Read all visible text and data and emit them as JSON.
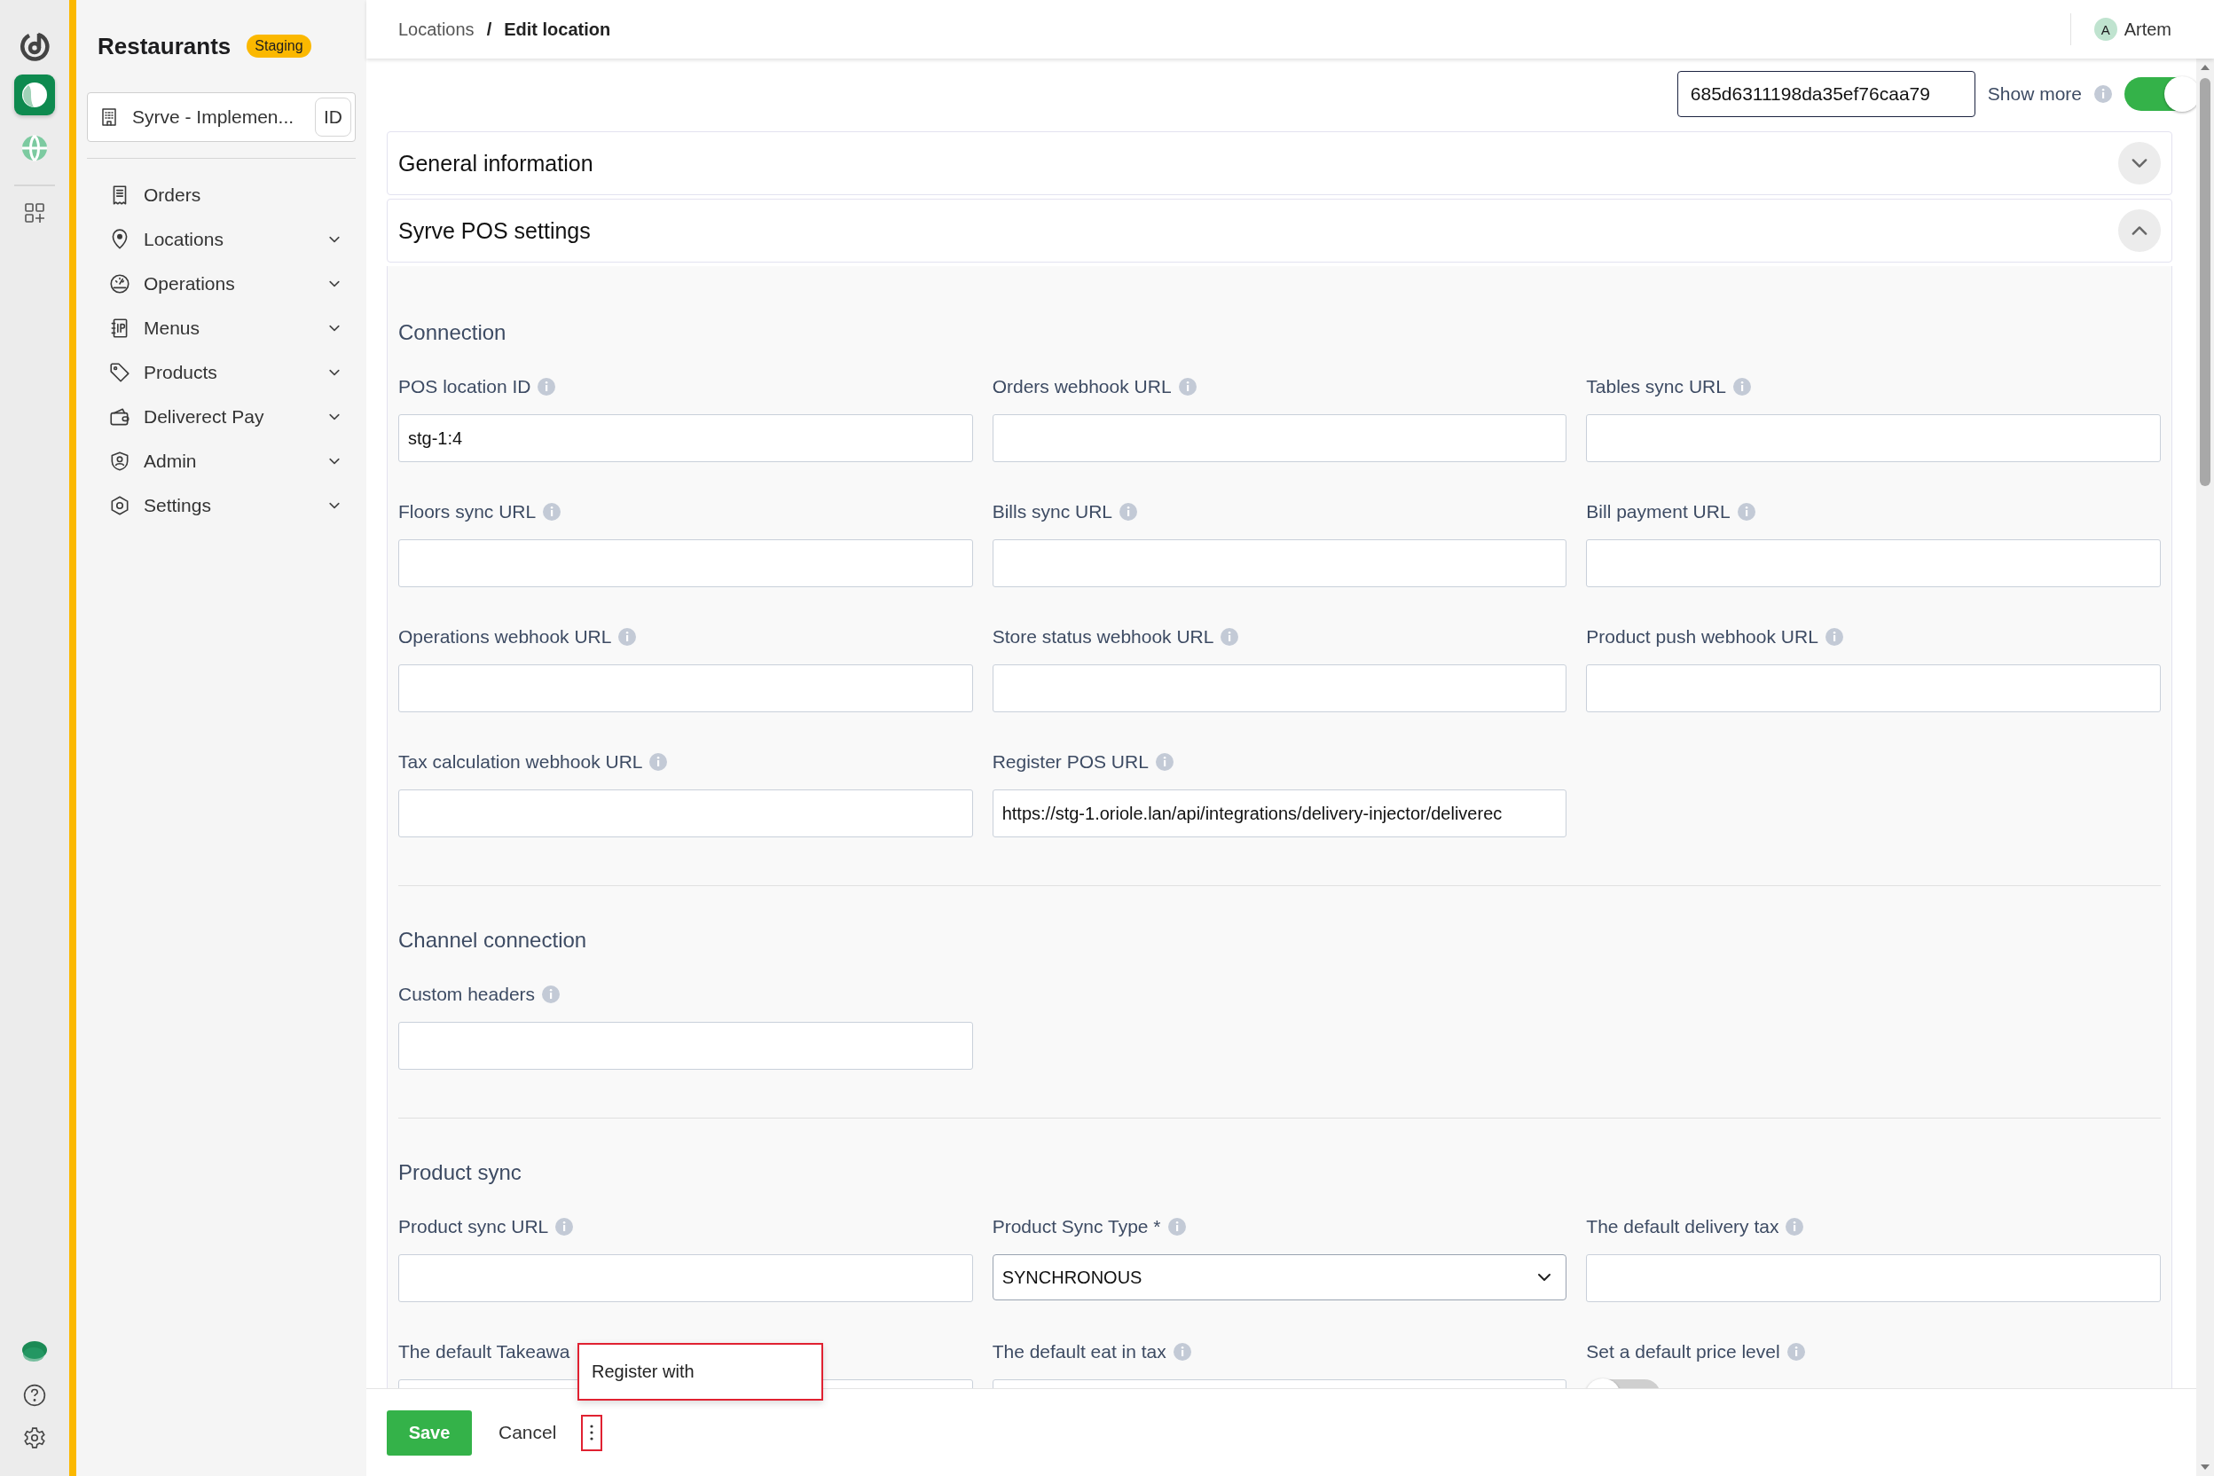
{
  "rail": {
    "items": [
      {
        "kind": "logo"
      },
      {
        "kind": "app",
        "selected": true
      },
      {
        "kind": "globe",
        "selected": false
      },
      {
        "kind": "apps"
      }
    ],
    "bottom": [
      {
        "kind": "blob"
      },
      {
        "kind": "help"
      },
      {
        "kind": "settings"
      }
    ]
  },
  "sidebar": {
    "title": "Restaurants",
    "badge": "Staging",
    "account": {
      "name": "Syrve - Implemen...",
      "tag": "ID"
    },
    "items": [
      {
        "label": "Orders",
        "expandable": false
      },
      {
        "label": "Locations",
        "expandable": true
      },
      {
        "label": "Operations",
        "expandable": true
      },
      {
        "label": "Menus",
        "expandable": true
      },
      {
        "label": "Products",
        "expandable": true
      },
      {
        "label": "Deliverect Pay",
        "expandable": true
      },
      {
        "label": "Admin",
        "expandable": true
      },
      {
        "label": "Settings",
        "expandable": true
      }
    ]
  },
  "topbar": {
    "breadcrumb": [
      "Locations",
      "Edit location"
    ],
    "breadcrumb_separator": "/",
    "user": {
      "initial": "A",
      "name": "Artem"
    }
  },
  "toolbar": {
    "id_value": "685d6311198da35ef76caa79",
    "show_more": {
      "label": "Show more",
      "on": true
    }
  },
  "panels": [
    {
      "title": "General information",
      "expanded": false
    },
    {
      "title": "Syrve POS settings",
      "expanded": true
    }
  ],
  "sections": [
    {
      "heading": "Connection",
      "fields": [
        {
          "kind": "text",
          "label": "POS location ID",
          "info": true,
          "value": "stg-1:4"
        },
        {
          "kind": "text",
          "label": "Orders webhook URL",
          "info": true
        },
        {
          "kind": "text",
          "label": "Tables sync URL",
          "info": true
        },
        {
          "kind": "text",
          "label": "Floors sync URL",
          "info": true
        },
        {
          "kind": "text",
          "label": "Bills sync URL",
          "info": true
        },
        {
          "kind": "text",
          "label": "Bill payment URL",
          "info": true
        },
        {
          "kind": "text",
          "label": "Operations webhook URL",
          "info": true
        },
        {
          "kind": "text",
          "label": "Store status webhook URL",
          "info": true
        },
        {
          "kind": "text",
          "label": "Product push webhook URL",
          "info": true
        },
        {
          "kind": "text",
          "label": "Tax calculation webhook URL",
          "info": true
        },
        {
          "kind": "text",
          "label": "Register POS URL",
          "info": true,
          "value": "https://stg-1.oriole.lan/api/integrations/delivery-injector/deliverec"
        }
      ]
    },
    {
      "heading": "Channel connection",
      "fields": [
        {
          "kind": "text",
          "label": "Custom headers",
          "info": true
        }
      ]
    },
    {
      "heading": "Product sync",
      "fields": [
        {
          "kind": "text",
          "label": "Product sync URL",
          "info": true
        },
        {
          "kind": "select",
          "label": "Product Sync Type *",
          "info": true,
          "value": "SYNCHRONOUS"
        },
        {
          "kind": "text",
          "label": "The default delivery tax",
          "info": true
        },
        {
          "kind": "text",
          "label": "The default Takeawa",
          "info": false
        },
        {
          "kind": "text",
          "label": "The default eat in tax",
          "info": true
        },
        {
          "kind": "toggle",
          "label": "Set a default price level",
          "info": true,
          "on": false
        }
      ]
    }
  ],
  "footer": {
    "save": "Save",
    "cancel": "Cancel"
  },
  "popup": {
    "items": [
      "Register with"
    ]
  }
}
